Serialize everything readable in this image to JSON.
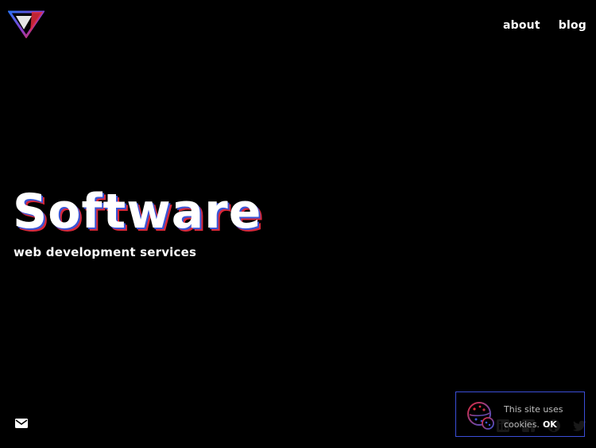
{
  "header": {
    "nav": [
      {
        "label": "about"
      },
      {
        "label": "blog"
      }
    ]
  },
  "hero": {
    "title": "Software",
    "subtitle": "web development services"
  },
  "footer": {
    "social_icons": [
      "linkedin-icon",
      "facebook-icon",
      "github-icon",
      "twitter-icon"
    ],
    "mail_icon": "mail-icon"
  },
  "cookie_banner": {
    "text": "This site uses cookies.",
    "ok_label": "OK"
  },
  "colors": {
    "background": "#000000",
    "accent_blue": "#3a55d6",
    "accent_red": "#d8283a",
    "text": "#ffffff"
  }
}
